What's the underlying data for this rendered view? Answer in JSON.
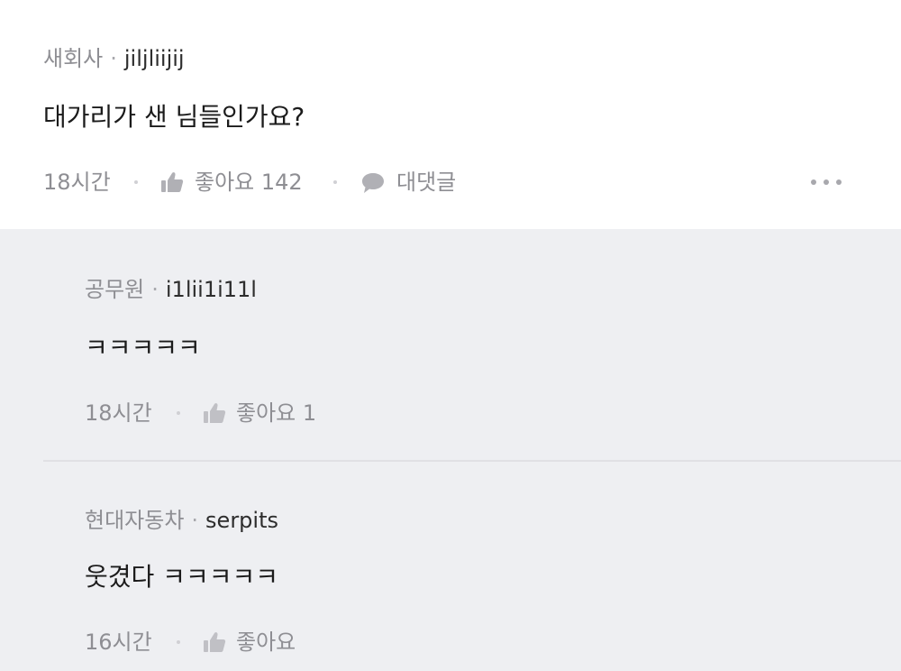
{
  "comment": {
    "company": "새회사",
    "separator": "·",
    "nickname": "jiljliijij",
    "text": "대가리가 샌 님들인가요?",
    "time": "18시간",
    "like_label": "좋아요",
    "like_count": "142",
    "reply_label": "대댓글"
  },
  "replies": [
    {
      "company": "공무원",
      "separator": "·",
      "nickname": "i1lii1i11l",
      "text": "ㅋㅋㅋㅋㅋ",
      "time": "18시간",
      "like_label": "좋아요",
      "like_count": "1"
    },
    {
      "company": "현대자동차",
      "separator": "·",
      "nickname": "serpits",
      "text": "웃겼다 ㅋㅋㅋㅋㅋ",
      "time": "16시간",
      "like_label": "좋아요",
      "like_count": ""
    }
  ],
  "icons": {
    "like": "thumbs-up-icon",
    "reply": "speech-bubble-icon",
    "more": "more-dots-icon"
  },
  "colors": {
    "main_bg": "#ffffff",
    "reply_bg": "#eeeff2",
    "meta_text": "#8e8e93",
    "body_text": "#1b1b1b"
  }
}
